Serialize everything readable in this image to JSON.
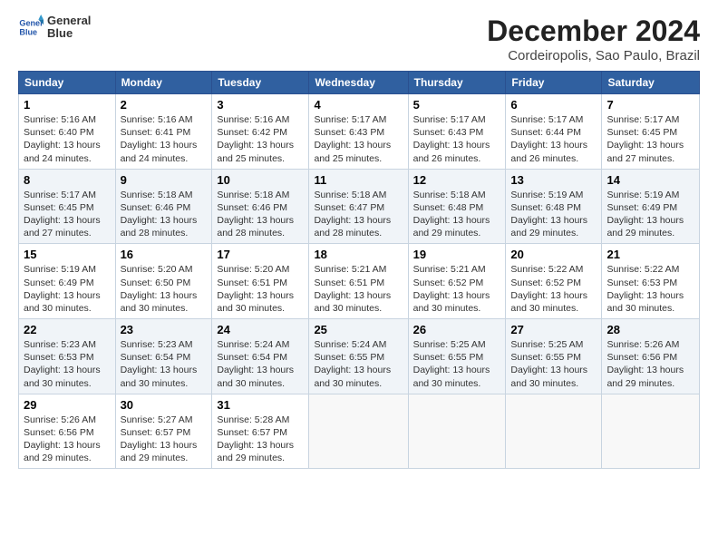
{
  "logo": {
    "line1": "General",
    "line2": "Blue"
  },
  "title": "December 2024",
  "subtitle": "Cordeiropolis, Sao Paulo, Brazil",
  "headers": [
    "Sunday",
    "Monday",
    "Tuesday",
    "Wednesday",
    "Thursday",
    "Friday",
    "Saturday"
  ],
  "weeks": [
    [
      {
        "day": "1",
        "sunrise": "5:16 AM",
        "sunset": "6:40 PM",
        "daylight": "13 hours and 24 minutes."
      },
      {
        "day": "2",
        "sunrise": "5:16 AM",
        "sunset": "6:41 PM",
        "daylight": "13 hours and 24 minutes."
      },
      {
        "day": "3",
        "sunrise": "5:16 AM",
        "sunset": "6:42 PM",
        "daylight": "13 hours and 25 minutes."
      },
      {
        "day": "4",
        "sunrise": "5:17 AM",
        "sunset": "6:43 PM",
        "daylight": "13 hours and 25 minutes."
      },
      {
        "day": "5",
        "sunrise": "5:17 AM",
        "sunset": "6:43 PM",
        "daylight": "13 hours and 26 minutes."
      },
      {
        "day": "6",
        "sunrise": "5:17 AM",
        "sunset": "6:44 PM",
        "daylight": "13 hours and 26 minutes."
      },
      {
        "day": "7",
        "sunrise": "5:17 AM",
        "sunset": "6:45 PM",
        "daylight": "13 hours and 27 minutes."
      }
    ],
    [
      {
        "day": "8",
        "sunrise": "5:17 AM",
        "sunset": "6:45 PM",
        "daylight": "13 hours and 27 minutes."
      },
      {
        "day": "9",
        "sunrise": "5:18 AM",
        "sunset": "6:46 PM",
        "daylight": "13 hours and 28 minutes."
      },
      {
        "day": "10",
        "sunrise": "5:18 AM",
        "sunset": "6:46 PM",
        "daylight": "13 hours and 28 minutes."
      },
      {
        "day": "11",
        "sunrise": "5:18 AM",
        "sunset": "6:47 PM",
        "daylight": "13 hours and 28 minutes."
      },
      {
        "day": "12",
        "sunrise": "5:18 AM",
        "sunset": "6:48 PM",
        "daylight": "13 hours and 29 minutes."
      },
      {
        "day": "13",
        "sunrise": "5:19 AM",
        "sunset": "6:48 PM",
        "daylight": "13 hours and 29 minutes."
      },
      {
        "day": "14",
        "sunrise": "5:19 AM",
        "sunset": "6:49 PM",
        "daylight": "13 hours and 29 minutes."
      }
    ],
    [
      {
        "day": "15",
        "sunrise": "5:19 AM",
        "sunset": "6:49 PM",
        "daylight": "13 hours and 30 minutes."
      },
      {
        "day": "16",
        "sunrise": "5:20 AM",
        "sunset": "6:50 PM",
        "daylight": "13 hours and 30 minutes."
      },
      {
        "day": "17",
        "sunrise": "5:20 AM",
        "sunset": "6:51 PM",
        "daylight": "13 hours and 30 minutes."
      },
      {
        "day": "18",
        "sunrise": "5:21 AM",
        "sunset": "6:51 PM",
        "daylight": "13 hours and 30 minutes."
      },
      {
        "day": "19",
        "sunrise": "5:21 AM",
        "sunset": "6:52 PM",
        "daylight": "13 hours and 30 minutes."
      },
      {
        "day": "20",
        "sunrise": "5:22 AM",
        "sunset": "6:52 PM",
        "daylight": "13 hours and 30 minutes."
      },
      {
        "day": "21",
        "sunrise": "5:22 AM",
        "sunset": "6:53 PM",
        "daylight": "13 hours and 30 minutes."
      }
    ],
    [
      {
        "day": "22",
        "sunrise": "5:23 AM",
        "sunset": "6:53 PM",
        "daylight": "13 hours and 30 minutes."
      },
      {
        "day": "23",
        "sunrise": "5:23 AM",
        "sunset": "6:54 PM",
        "daylight": "13 hours and 30 minutes."
      },
      {
        "day": "24",
        "sunrise": "5:24 AM",
        "sunset": "6:54 PM",
        "daylight": "13 hours and 30 minutes."
      },
      {
        "day": "25",
        "sunrise": "5:24 AM",
        "sunset": "6:55 PM",
        "daylight": "13 hours and 30 minutes."
      },
      {
        "day": "26",
        "sunrise": "5:25 AM",
        "sunset": "6:55 PM",
        "daylight": "13 hours and 30 minutes."
      },
      {
        "day": "27",
        "sunrise": "5:25 AM",
        "sunset": "6:55 PM",
        "daylight": "13 hours and 30 minutes."
      },
      {
        "day": "28",
        "sunrise": "5:26 AM",
        "sunset": "6:56 PM",
        "daylight": "13 hours and 29 minutes."
      }
    ],
    [
      {
        "day": "29",
        "sunrise": "5:26 AM",
        "sunset": "6:56 PM",
        "daylight": "13 hours and 29 minutes."
      },
      {
        "day": "30",
        "sunrise": "5:27 AM",
        "sunset": "6:57 PM",
        "daylight": "13 hours and 29 minutes."
      },
      {
        "day": "31",
        "sunrise": "5:28 AM",
        "sunset": "6:57 PM",
        "daylight": "13 hours and 29 minutes."
      },
      null,
      null,
      null,
      null
    ]
  ]
}
